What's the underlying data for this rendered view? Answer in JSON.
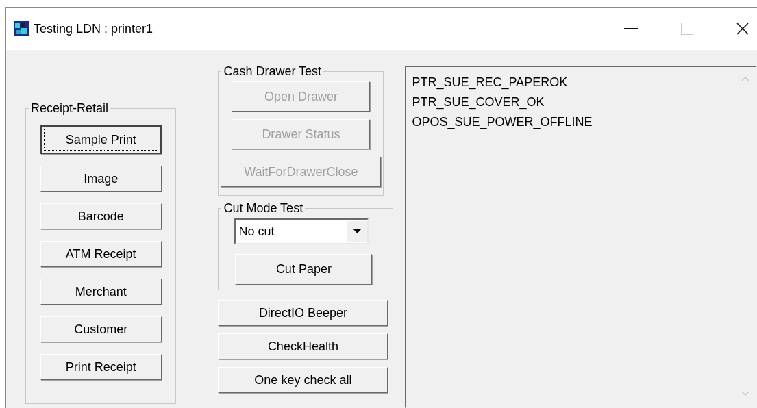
{
  "window": {
    "title": "Testing LDN : printer1"
  },
  "receipt_group": {
    "title": "Receipt-Retail",
    "buttons": [
      {
        "label": "Sample Print",
        "focused": true
      },
      {
        "label": "Image",
        "focused": false
      },
      {
        "label": "Barcode",
        "focused": false
      },
      {
        "label": "ATM Receipt",
        "focused": false
      },
      {
        "label": "Merchant",
        "focused": false
      },
      {
        "label": "Customer",
        "focused": false
      },
      {
        "label": "Print Receipt",
        "focused": false
      }
    ]
  },
  "cash_drawer_group": {
    "title": "Cash Drawer Test",
    "buttons": [
      {
        "label": "Open Drawer",
        "disabled": true
      },
      {
        "label": "Drawer Status",
        "disabled": true
      },
      {
        "label": "WaitForDrawerClose",
        "disabled": true
      }
    ]
  },
  "cut_mode_group": {
    "title": "Cut Mode Test",
    "dropdown": {
      "value": "No cut"
    },
    "button": "Cut Paper"
  },
  "buttons": [
    "DirectIO  Beeper",
    "CheckHealth",
    "One key check all"
  ],
  "status_list": [
    "PTR_SUE_REC_PAPEROK",
    "PTR_SUE_COVER_OK",
    "OPOS_SUE_POWER_OFFLINE"
  ]
}
